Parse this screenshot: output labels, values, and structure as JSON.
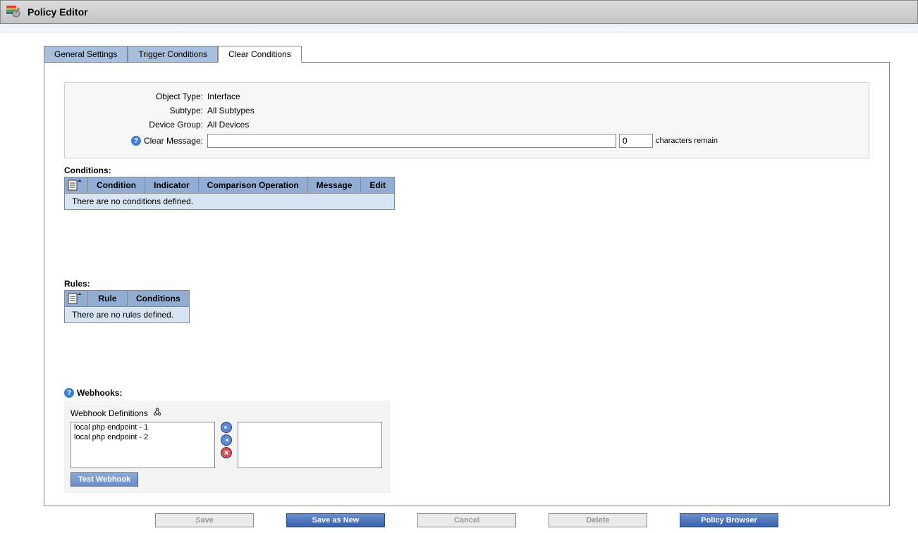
{
  "header": {
    "title": "Policy Editor"
  },
  "tabs": {
    "general": "General Settings",
    "trigger": "Trigger Conditions",
    "clear": "Clear Conditions"
  },
  "info": {
    "object_type_label": "Object Type:",
    "object_type_value": "Interface",
    "subtype_label": "Subtype:",
    "subtype_value": "All Subtypes",
    "device_group_label": "Device Group:",
    "device_group_value": "All Devices",
    "clear_message_label": "Clear Message:",
    "clear_message_value": "",
    "char_count_value": "0",
    "char_remain_text": "characters remain"
  },
  "conditions": {
    "section_label": "Conditions:",
    "cols": {
      "condition": "Condition",
      "indicator": "Indicator",
      "comparison": "Comparison Operation",
      "message": "Message",
      "edit": "Edit"
    },
    "empty_text": "There are no conditions defined."
  },
  "rules": {
    "section_label": "Rules:",
    "cols": {
      "rule": "Rule",
      "conditions": "Conditions"
    },
    "empty_text": "There are no rules defined."
  },
  "webhooks": {
    "section_label": "Webhooks:",
    "defs_label": "Webhook Definitions",
    "items": {
      "0": "local php endpoint - 1",
      "1": "local php endpoint - 2"
    },
    "test_button": "Test Webhook"
  },
  "buttons": {
    "save": "Save",
    "save_as_new": "Save as New",
    "cancel": "Cancel",
    "delete": "Delete",
    "policy_browser": "Policy Browser"
  }
}
